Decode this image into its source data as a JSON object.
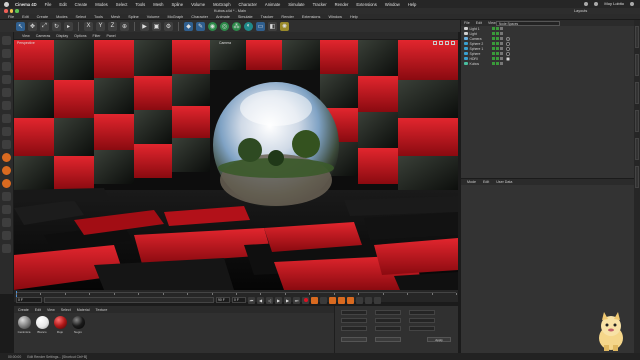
{
  "menubar": {
    "app": "Cinema 4D",
    "items": [
      "File",
      "Edit",
      "Create",
      "Modes",
      "Select",
      "Tools",
      "Mesh",
      "Spline",
      "Volume",
      "MoGraph",
      "Character",
      "Animate",
      "Simulate",
      "Tracker",
      "Render",
      "Extensions",
      "Window",
      "Help"
    ],
    "user": "Moy Lobito"
  },
  "window": {
    "title": "Kubos.c4d * - Main",
    "layout_label": "Layouts"
  },
  "app_menu": [
    "File",
    "Edit",
    "Create",
    "Modes",
    "Select",
    "Tools",
    "Mesh",
    "Spline",
    "Volume",
    "MoGraph",
    "Character",
    "Animate",
    "Simulate",
    "Tracker",
    "Render",
    "Extensions",
    "Window",
    "Help"
  ],
  "viewport": {
    "menu": [
      "View",
      "Cameras",
      "Display",
      "Options",
      "Filter",
      "Panel"
    ],
    "label_left": "Perspective",
    "label_center": "Camera"
  },
  "timeline": {
    "start": "0 F",
    "end": "90 F",
    "current": "0 F",
    "ticks": [
      "0",
      "5",
      "10",
      "15",
      "20",
      "25",
      "30",
      "35",
      "40",
      "45",
      "50",
      "55",
      "60",
      "65",
      "70",
      "75",
      "80",
      "85",
      "90"
    ]
  },
  "materials": {
    "menu": [
      "Create",
      "Edit",
      "View",
      "Select",
      "Material",
      "Texture"
    ],
    "items": [
      {
        "name": "Cerámica",
        "color": "#8a8a8a"
      },
      {
        "name": "Blanco",
        "color": "#f2f2f2"
      },
      {
        "name": "Rojo",
        "color": "#b01818"
      },
      {
        "name": "Negro",
        "color": "#161616"
      }
    ]
  },
  "coords": {
    "apply": "Apply",
    "labels": [
      "X",
      "Y",
      "Z",
      "H",
      "P",
      "B"
    ],
    "mode_labels": [
      "Object (Rel)",
      "Size"
    ]
  },
  "object_manager": {
    "menu": [
      "File",
      "Edit",
      "View",
      "Object",
      "Tags",
      "Bookmarks"
    ],
    "space": "Node Spaces",
    "objects": [
      {
        "name": "Light 1",
        "color": "#d0d0d0",
        "tag": ""
      },
      {
        "name": "Light",
        "color": "#d0d0d0",
        "tag": ""
      },
      {
        "name": "Camera",
        "color": "#6ab0e0",
        "tag": "#333"
      },
      {
        "name": "Sphere 2",
        "color": "#3aa0d0",
        "tag": "#111"
      },
      {
        "name": "Sphere 1",
        "color": "#3aa0d0",
        "tag": "#111"
      },
      {
        "name": "Sphere",
        "color": "#3aa0d0",
        "tag": "#111"
      },
      {
        "name": "HDRI",
        "color": "#3aa0d0",
        "tag": "#f0f0f0"
      },
      {
        "name": "Kubos",
        "color": "#4abfa0",
        "tag": ""
      }
    ]
  },
  "attributes": {
    "menu": [
      "Mode",
      "Edit",
      "User Data"
    ]
  },
  "status": {
    "time": "00:00:00",
    "message": "Edit Render Settings... [Shortcut Ctrl+B]"
  },
  "colors": {
    "accent": "#4a90d9",
    "cube_red": "#c2121c",
    "cube_black": "#141414",
    "orange": "#d96a20"
  }
}
